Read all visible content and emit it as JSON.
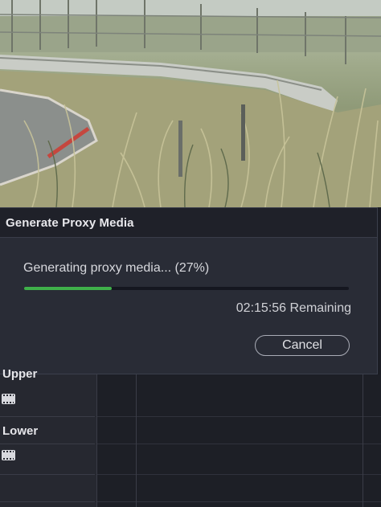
{
  "dialog": {
    "title": "Generate Proxy Media",
    "status_text": "Generating proxy media... (27%)",
    "progress": 0.27,
    "remaining_text": "02:15:56 Remaining",
    "cancel_label": "Cancel",
    "accent_color": "#3fb04a"
  },
  "tracks": [
    {
      "label": "Upper",
      "icon": "film-icon"
    },
    {
      "label": "Lower",
      "icon": "film-icon"
    }
  ]
}
